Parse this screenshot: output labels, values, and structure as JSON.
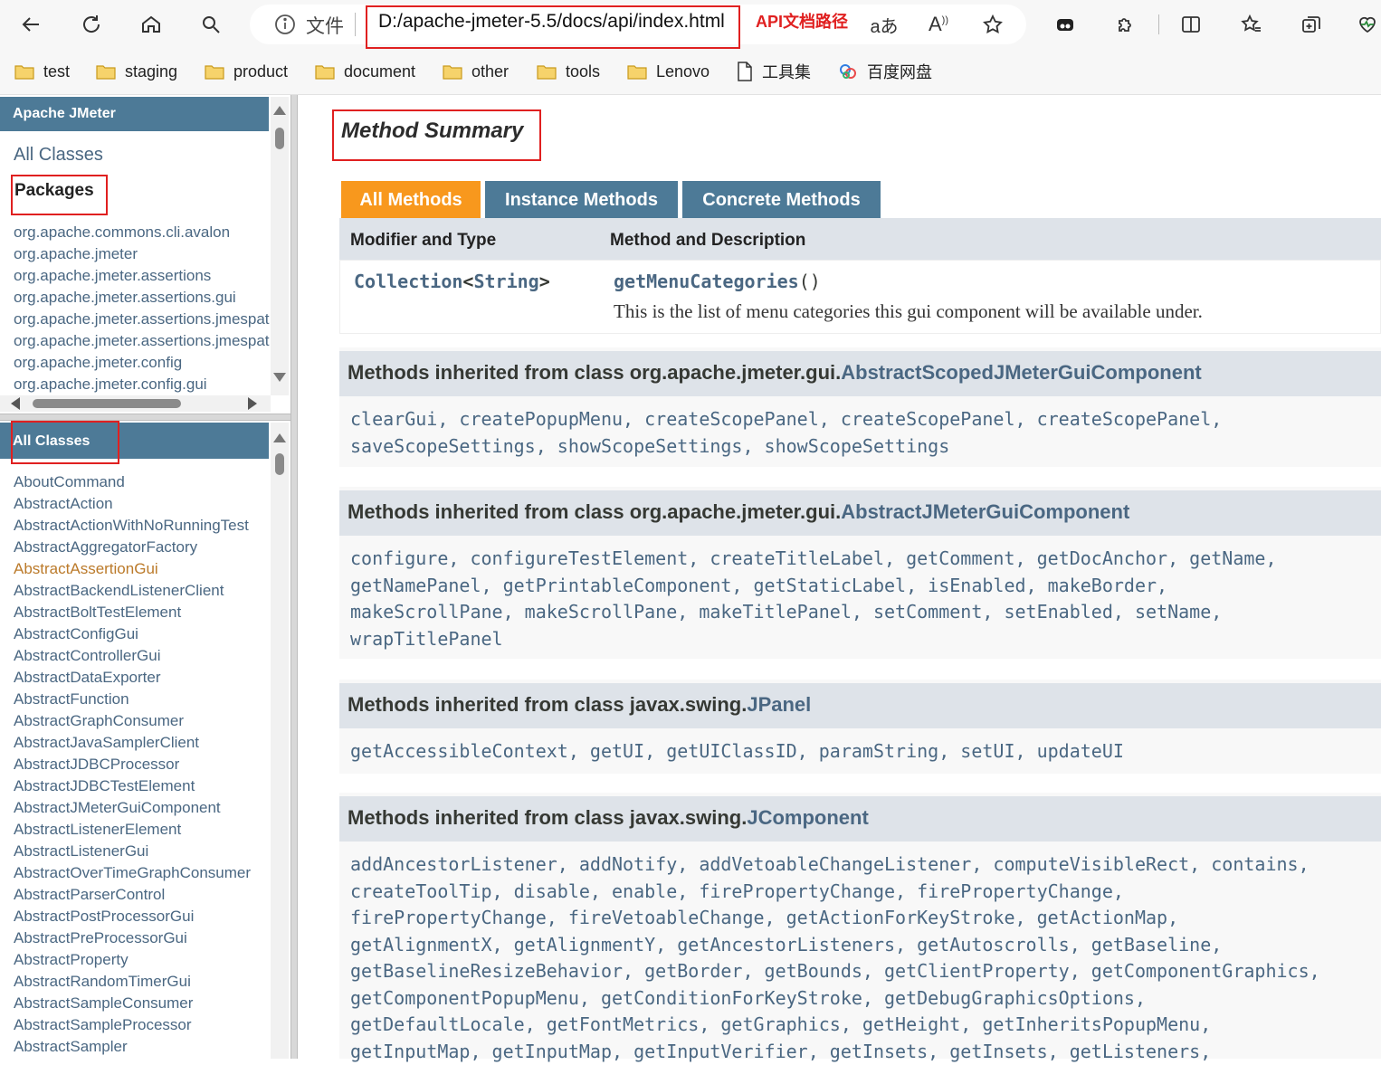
{
  "browser": {
    "address_prefix": "文件",
    "url": "D:/apache-jmeter-5.5/docs/api/index.html",
    "annotation": "API文档路径"
  },
  "bookmarks": [
    "test",
    "staging",
    "product",
    "document",
    "other",
    "tools",
    "Lenovo",
    "工具集",
    "百度网盘"
  ],
  "left_top": {
    "header": "Apache JMeter",
    "all_classes_link": "All Classes",
    "packages_heading": "Packages",
    "packages": [
      "org.apache.commons.cli.avalon",
      "org.apache.jmeter",
      "org.apache.jmeter.assertions",
      "org.apache.jmeter.assertions.gui",
      "org.apache.jmeter.assertions.jmespath",
      "org.apache.jmeter.assertions.jmespath.gui",
      "org.apache.jmeter.config",
      "org.apache.jmeter.config.gui"
    ]
  },
  "left_bottom": {
    "header": "All Classes",
    "classes": [
      "AboutCommand",
      "AbstractAction",
      "AbstractActionWithNoRunningTest",
      "AbstractAggregatorFactory",
      "AbstractAssertionGui",
      "AbstractBackendListenerClient",
      "AbstractBoltTestElement",
      "AbstractConfigGui",
      "AbstractControllerGui",
      "AbstractDataExporter",
      "AbstractFunction",
      "AbstractGraphConsumer",
      "AbstractJavaSamplerClient",
      "AbstractJDBCProcessor",
      "AbstractJDBCTestElement",
      "AbstractJMeterGuiComponent",
      "AbstractListenerElement",
      "AbstractListenerGui",
      "AbstractOverTimeGraphConsumer",
      "AbstractParserControl",
      "AbstractPostProcessorGui",
      "AbstractPreProcessorGui",
      "AbstractProperty",
      "AbstractRandomTimerGui",
      "AbstractSampleConsumer",
      "AbstractSampleProcessor",
      "AbstractSampler"
    ],
    "highlighted_index": 4
  },
  "main": {
    "section_title": "Method Summary",
    "tabs": [
      "All Methods",
      "Instance Methods",
      "Concrete Methods"
    ],
    "columns": [
      "Modifier and Type",
      "Method and Description"
    ],
    "row": {
      "type_a": "Collection",
      "type_lt": "<",
      "type_b": "String",
      "type_gt": ">",
      "method": "getMenuCategories",
      "parens": "()",
      "description": "This is the list of menu categories this gui component will be available under."
    },
    "inherited": [
      {
        "prefix": "Methods inherited from class org.apache.jmeter.gui.",
        "class": "AbstractScopedJMeterGuiComponent",
        "methods": "clearGui, createPopupMenu, createScopePanel, createScopePanel, createScopePanel,\nsaveScopeSettings, showScopeSettings, showScopeSettings"
      },
      {
        "prefix": "Methods inherited from class org.apache.jmeter.gui.",
        "class": "AbstractJMeterGuiComponent",
        "methods": "configure, configureTestElement, createTitleLabel, getComment, getDocAnchor, getName,\ngetNamePanel, getPrintableComponent, getStaticLabel, isEnabled, makeBorder,\nmakeScrollPane, makeScrollPane, makeTitlePanel, setComment, setEnabled, setName,\nwrapTitlePanel"
      },
      {
        "prefix": "Methods inherited from class javax.swing.",
        "class": "JPanel",
        "methods": "getAccessibleContext, getUI, getUIClassID, paramString, setUI, updateUI"
      },
      {
        "prefix": "Methods inherited from class javax.swing.",
        "class": "JComponent",
        "methods": "addAncestorListener, addNotify, addVetoableChangeListener, computeVisibleRect, contains,\ncreateToolTip, disable, enable, firePropertyChange, firePropertyChange,\nfirePropertyChange, fireVetoableChange, getActionForKeyStroke, getActionMap,\ngetAlignmentX, getAlignmentY, getAncestorListeners, getAutoscrolls, getBaseline,\ngetBaselineResizeBehavior, getBorder, getBounds, getClientProperty, getComponentGraphics,\ngetComponentPopupMenu, getConditionForKeyStroke, getDebugGraphicsOptions,\ngetDefaultLocale, getFontMetrics, getGraphics, getHeight, getInheritsPopupMenu,\ngetInputMap, getInputMap, getInputVerifier, getInsets, getInsets, getListeners,"
      }
    ]
  },
  "colors": {
    "header_blue": "#4d7a97",
    "tab_active": "#f8981d",
    "link": "#4a6782",
    "highlight": "#bb7a2a",
    "annotation_red": "#e02020"
  }
}
